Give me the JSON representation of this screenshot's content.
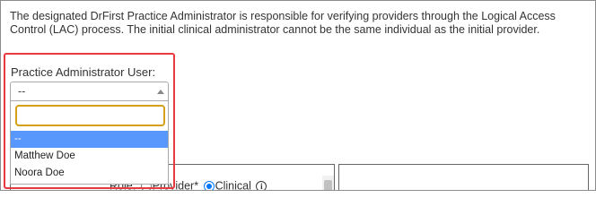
{
  "intro_text": "The designated DrFirst Practice Administrator is responsible for verifying providers through the Logical Access Control (LAC) process. The initial clinical administrator cannot be the same individual as the initial provider.",
  "practice_admin": {
    "label": "Practice Administrator User:",
    "selected_value": "--",
    "search_value": "",
    "options": [
      "--",
      "Matthew Doe",
      "Noora Doe"
    ]
  },
  "role_row": {
    "label": "Role:",
    "option_provider": "Provider*",
    "option_clinical": "Clinical",
    "selected": "Clinical"
  },
  "colors": {
    "highlight": "#e8393e",
    "option_selected_bg": "#5897fb",
    "search_focus": "#d4a018",
    "radio_checked": "#0075ff"
  }
}
